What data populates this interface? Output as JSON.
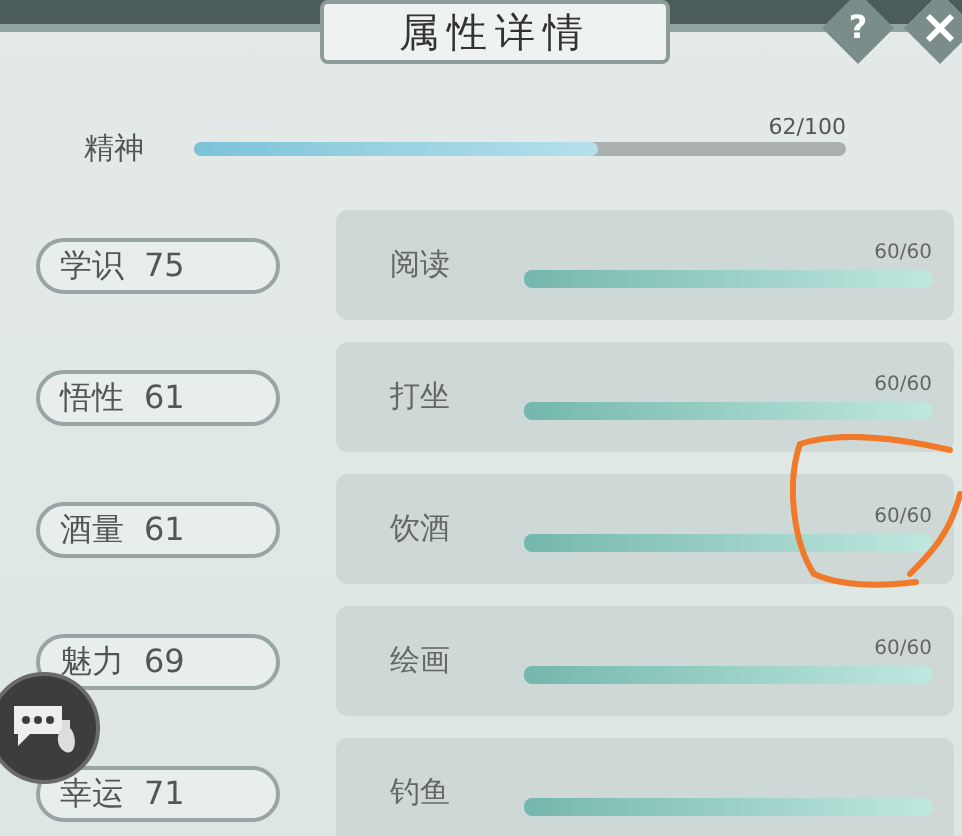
{
  "header": {
    "title": "属性详情",
    "help": "?"
  },
  "spirit": {
    "label": "精神",
    "level": 0.62,
    "reading": "62/100"
  },
  "rows": [
    {
      "attribute": {
        "label": "学识",
        "value": "75"
      },
      "skill": {
        "label": "阅读",
        "level": 1,
        "reading": "60/60"
      }
    },
    {
      "attribute": {
        "label": "悟性",
        "value": "61"
      },
      "skill": {
        "label": "打坐",
        "level": 1,
        "reading": "60/60"
      }
    },
    {
      "attribute": {
        "label": "酒量",
        "value": "61"
      },
      "skill": {
        "label": "饮酒",
        "level": 1,
        "reading": "60/60"
      }
    },
    {
      "attribute": {
        "label": "魅力",
        "value": "69"
      },
      "skill": {
        "label": "绘画",
        "level": 1,
        "reading": "60/60"
      }
    },
    {
      "attribute": {
        "label": "幸运",
        "value": "71"
      },
      "skill": {
        "label": "钓鱼",
        "level": 1
      }
    }
  ]
}
